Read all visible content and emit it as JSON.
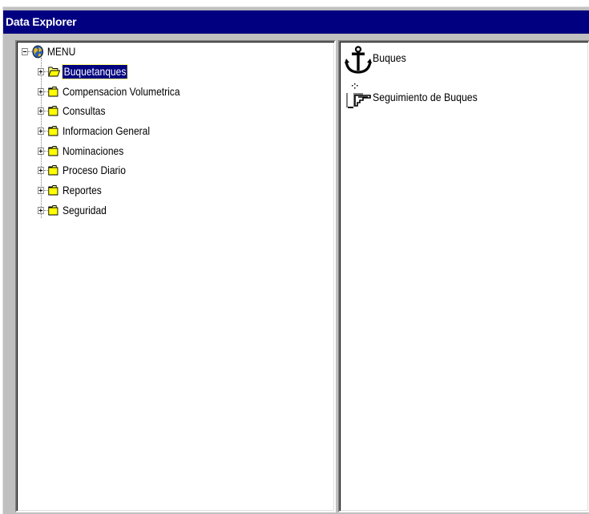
{
  "window": {
    "title": "Data Explorer",
    "title_bar_color": "#000080",
    "background": "#c0c0c0"
  },
  "tree": {
    "root": {
      "label": "MENU",
      "icon": "globe-icon",
      "expanded": true
    },
    "items": [
      {
        "label": "Buquetanques",
        "icon": "open-folder-icon",
        "selected": true
      },
      {
        "label": "Compensacion Volumetrica",
        "icon": "folder-icon",
        "selected": false
      },
      {
        "label": "Consultas",
        "icon": "folder-icon",
        "selected": false
      },
      {
        "label": "Informacion General",
        "icon": "folder-icon",
        "selected": false
      },
      {
        "label": "Nominaciones",
        "icon": "folder-icon",
        "selected": false
      },
      {
        "label": "Proceso Diario",
        "icon": "folder-icon",
        "selected": false
      },
      {
        "label": "Reportes",
        "icon": "folder-icon",
        "selected": false
      },
      {
        "label": "Seguridad",
        "icon": "folder-icon",
        "selected": false
      }
    ]
  },
  "list": {
    "items": [
      {
        "label": "Buques",
        "icon": "anchor-icon"
      },
      {
        "label": "Seguimiento de Buques",
        "icon": "pointing-hand-icon"
      }
    ]
  }
}
